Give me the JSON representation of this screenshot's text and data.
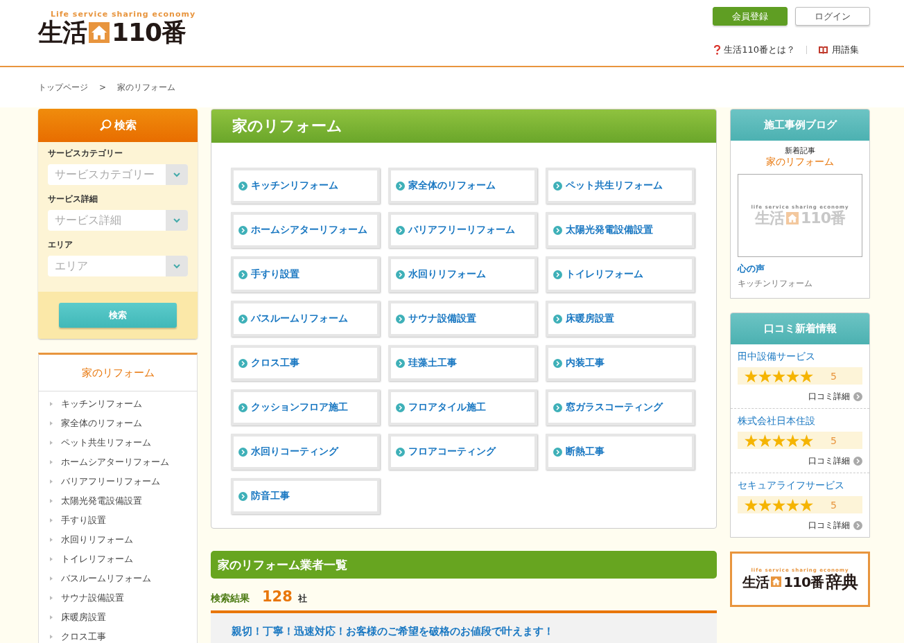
{
  "header": {
    "logo": {
      "tagline": "Life service sharing economy",
      "text_before": "生活",
      "text_after": "110番"
    },
    "buttons": [
      {
        "label": "会員登録",
        "kind": "primary"
      },
      {
        "label": "ログイン",
        "kind": "secondary"
      }
    ],
    "links": [
      {
        "label": "生活110番とは？",
        "kind": "help"
      },
      {
        "label": "用語集",
        "kind": "book"
      }
    ]
  },
  "breadcrumb": [
    "トップページ",
    "家のリフォーム"
  ],
  "breadcrumb_separator": ">",
  "search_panel": {
    "title": "検索",
    "fields": [
      {
        "label": "サービスカテゴリー",
        "placeholder": "サービスカテゴリー"
      },
      {
        "label": "サービス詳細",
        "placeholder": "サービス詳細"
      },
      {
        "label": "エリア",
        "placeholder": "エリア"
      }
    ],
    "button": "検索"
  },
  "category_menu": {
    "title": "家のリフォーム",
    "items": [
      "キッチンリフォーム",
      "家全体のリフォーム",
      "ペット共生リフォーム",
      "ホームシアターリフォーム",
      "バリアフリーリフォーム",
      "太陽光発電設備設置",
      "手すり設置",
      "水回りリフォーム",
      "トイレリフォーム",
      "バスルームリフォーム",
      "サウナ設備設置",
      "床暖房設置",
      "クロス工事"
    ]
  },
  "category_panel": {
    "title": "家のリフォーム",
    "items": [
      "キッチンリフォーム",
      "家全体のリフォーム",
      "ペット共生リフォーム",
      "ホームシアターリフォーム",
      "バリアフリーリフォーム",
      "太陽光発電設備設置",
      "手すり設置",
      "水回りリフォーム",
      "トイレリフォーム",
      "バスルームリフォーム",
      "サウナ設備設置",
      "床暖房設置",
      "クロス工事",
      "珪藻土工事",
      "内装工事",
      "クッションフロア施工",
      "フロアタイル施工",
      "窓ガラスコーティング",
      "水回りコーティング",
      "フロアコーティング",
      "断熱工事",
      "防音工事"
    ]
  },
  "listing": {
    "title": "家のリフォーム業者一覧",
    "result_label": "検索結果",
    "result_count": "128",
    "result_unit": "社",
    "first_card_title": "親切！丁寧！迅速対応！お客様のご希望を破格のお値段で叶えます！"
  },
  "blog": {
    "title": "施工事例ブログ",
    "subtitle": "新着記事",
    "category": "家のリフォーム",
    "thumbnail": {
      "tagline": "life service sharing economy",
      "text_before": "生活",
      "text_after": "110番"
    },
    "post_title": "心の声",
    "post_category": "キッチンリフォーム"
  },
  "reviews": {
    "title": "口コミ新着情報",
    "items": [
      {
        "company": "田中設備サービス",
        "stars": 5,
        "score": "5",
        "link": "口コミ詳細"
      },
      {
        "company": "株式会社日本住設",
        "stars": 5,
        "score": "5",
        "link": "口コミ詳細"
      },
      {
        "company": "セキュアライフサービス",
        "stars": 5,
        "score": "5",
        "link": "口コミ詳細"
      }
    ]
  },
  "banner": {
    "tagline": "life service sharing economy",
    "text_before": "生活",
    "text_after": "110番",
    "suffix": "辞典"
  }
}
